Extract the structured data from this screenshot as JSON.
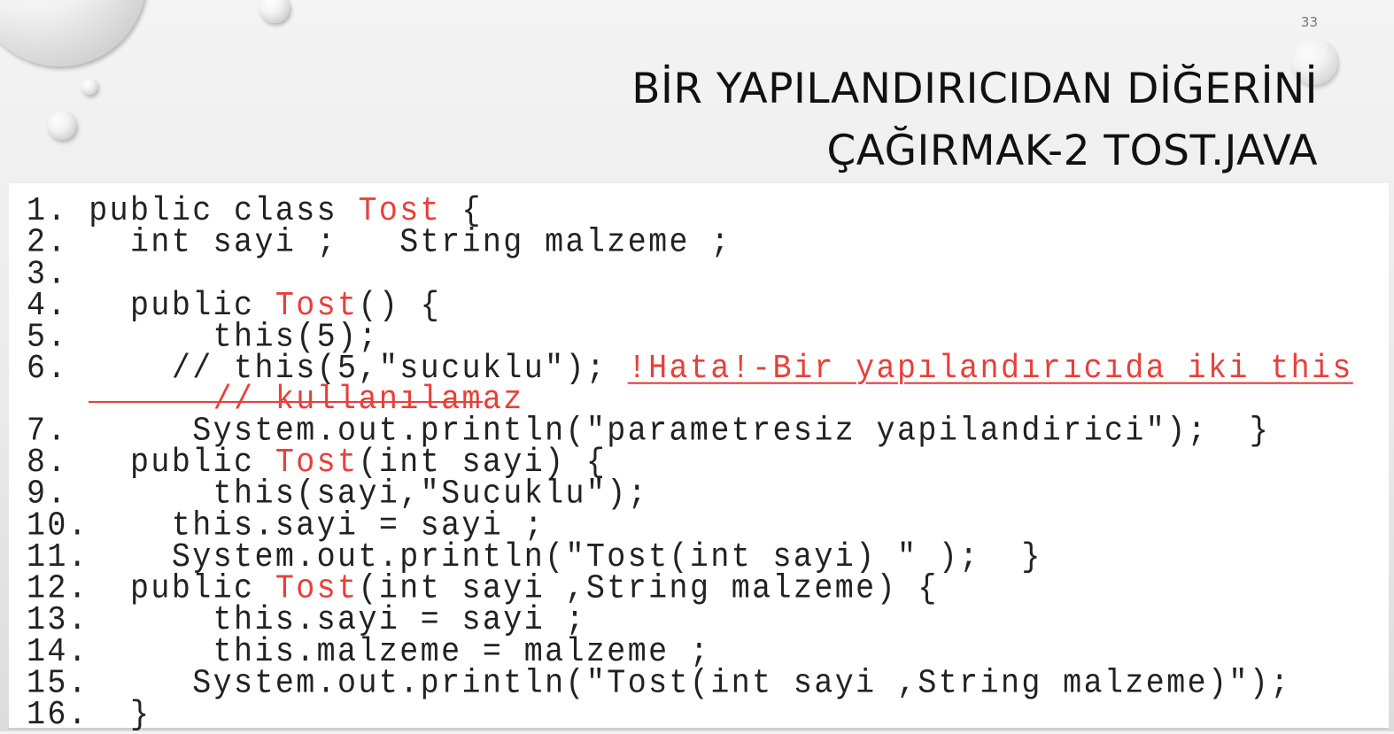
{
  "slide": {
    "page_number": "33",
    "title_line1": "BİR YAPILANDIRICIDAN DİĞERİNİ",
    "title_line2": "ÇAĞIRMAK-2 TOST.JAVA"
  },
  "colors": {
    "keyword_red": "#e8403a",
    "code_text": "#222222"
  },
  "code": [
    {
      "num": "1.",
      "segs": [
        {
          "t": " public class "
        },
        {
          "t": "Tost",
          "c": "red"
        },
        {
          "t": " {"
        }
      ]
    },
    {
      "num": "2.",
      "segs": [
        {
          "t": "   int sayi ;   String malzeme ;"
        }
      ]
    },
    {
      "num": "3.",
      "segs": []
    },
    {
      "num": "4.",
      "segs": [
        {
          "t": "   public "
        },
        {
          "t": "Tost",
          "c": "red"
        },
        {
          "t": "() {"
        }
      ]
    },
    {
      "num": "5.",
      "segs": [
        {
          "t": "       this(5);"
        }
      ]
    },
    {
      "num": "6.",
      "segs": [
        {
          "t": "     // this(5,\"sucuklu\"); "
        },
        {
          "t": "!Hata!-Bir yapılandırıcıda iki this",
          "c": "red ul"
        }
      ]
    },
    {
      "num": "",
      "segs": [
        {
          "t": "       "
        },
        {
          "t": "// kullanılamaz",
          "c": "red"
        }
      ]
    },
    {
      "num": "7.",
      "segs": [
        {
          "t": "      System.out.println(\"parametresiz yapilandirici\");  }"
        }
      ]
    },
    {
      "num": "8.",
      "segs": [
        {
          "t": "   public "
        },
        {
          "t": "Tost",
          "c": "red"
        },
        {
          "t": "(int sayi) {"
        }
      ]
    },
    {
      "num": "9.",
      "segs": [
        {
          "t": "       this(sayi,\"Sucuklu\");"
        }
      ]
    },
    {
      "num": "10.",
      "segs": [
        {
          "t": "    this.sayi = sayi ;"
        }
      ]
    },
    {
      "num": "11.",
      "segs": [
        {
          "t": "    System.out.println(\"Tost(int sayi) \" );  }"
        }
      ]
    },
    {
      "num": "12.",
      "segs": [
        {
          "t": "  public "
        },
        {
          "t": "Tost",
          "c": "red"
        },
        {
          "t": "(int sayi ,String malzeme) {"
        }
      ]
    },
    {
      "num": "13.",
      "segs": [
        {
          "t": "      this.sayi = sayi ;"
        }
      ]
    },
    {
      "num": "14.",
      "segs": [
        {
          "t": "      this.malzeme = malzeme ;"
        }
      ]
    },
    {
      "num": "15.",
      "segs": [
        {
          "t": "     System.out.println(\"Tost(int sayi ,String malzeme)\");"
        }
      ]
    },
    {
      "num": "16.",
      "segs": [
        {
          "t": "  }"
        }
      ]
    }
  ]
}
